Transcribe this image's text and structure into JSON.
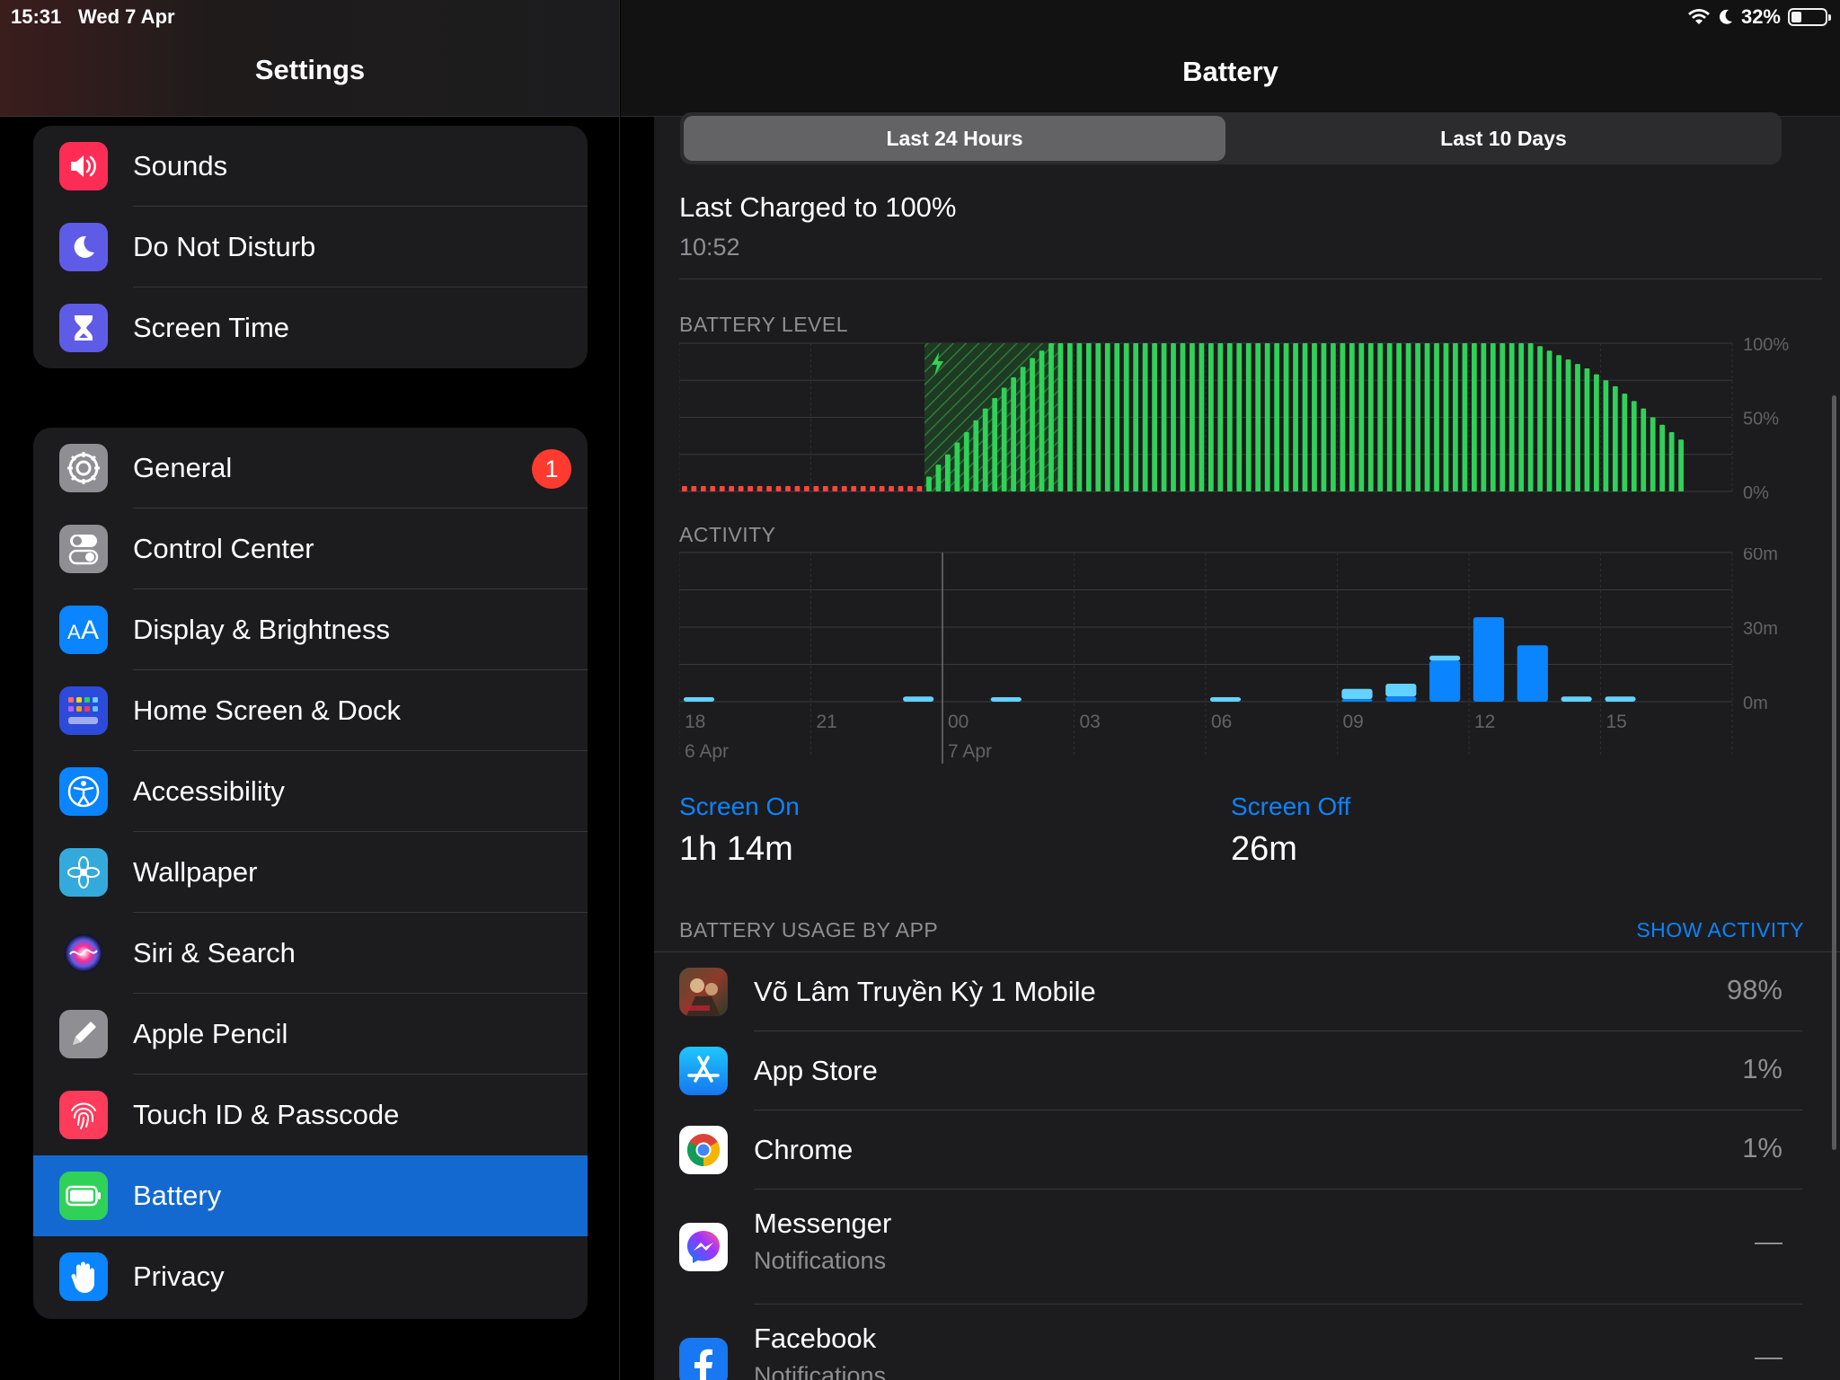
{
  "status_bar": {
    "time": "15:31",
    "date": "Wed 7 Apr",
    "battery_percent": "32%",
    "battery_level": 0.32
  },
  "sidebar": {
    "title": "Settings",
    "group1": [
      {
        "label": "Sounds",
        "icon": "speaker-icon",
        "color": "#ff2d55"
      },
      {
        "label": "Do Not Disturb",
        "icon": "moon-icon",
        "color": "#5e5ce6"
      },
      {
        "label": "Screen Time",
        "icon": "hourglass-icon",
        "color": "#5e5ce6"
      }
    ],
    "group2": [
      {
        "label": "General",
        "icon": "gear-icon",
        "color": "#8e8e93",
        "badge": "1"
      },
      {
        "label": "Control Center",
        "icon": "toggles-icon",
        "color": "#8e8e93"
      },
      {
        "label": "Display & Brightness",
        "icon": "text-size-icon",
        "color": "#0a84ff"
      },
      {
        "label": "Home Screen & Dock",
        "icon": "grid-icon",
        "color": "#2c4bdb"
      },
      {
        "label": "Accessibility",
        "icon": "accessibility-icon",
        "color": "#0a84ff"
      },
      {
        "label": "Wallpaper",
        "icon": "flower-icon",
        "color": "#34aadc"
      },
      {
        "label": "Siri & Search",
        "icon": "siri-icon",
        "color": "#1c1c1e"
      },
      {
        "label": "Apple Pencil",
        "icon": "pencil-icon",
        "color": "#8e8e93"
      },
      {
        "label": "Touch ID & Passcode",
        "icon": "fingerprint-icon",
        "color": "#ff3b5c"
      },
      {
        "label": "Battery",
        "icon": "battery-icon",
        "color": "#30d158",
        "selected": true
      },
      {
        "label": "Privacy",
        "icon": "hand-icon",
        "color": "#0a84ff"
      }
    ]
  },
  "detail": {
    "title": "Battery",
    "segments": [
      "Last 24 Hours",
      "Last 10 Days"
    ],
    "active_segment": "Last 24 Hours",
    "last_charged": "Last Charged to 100%",
    "last_charged_time": "10:52",
    "screen_on_label": "Screen On",
    "screen_on_value": "1h 14m",
    "screen_off_label": "Screen Off",
    "screen_off_value": "26m",
    "usage_header": "BATTERY USAGE BY APP",
    "show_activity": "SHOW ACTIVITY",
    "apps": [
      {
        "name": "Võ Lâm Truyền Kỳ 1 Mobile",
        "pct": "98%",
        "icon": "game-icon"
      },
      {
        "name": "App Store",
        "pct": "1%",
        "icon": "app-store-icon"
      },
      {
        "name": "Chrome",
        "pct": "1%",
        "icon": "chrome-icon"
      },
      {
        "name": "Messenger",
        "sub": "Notifications",
        "pct": "—",
        "icon": "messenger-icon"
      },
      {
        "name": "Facebook",
        "sub": "Notifications",
        "pct": "—",
        "icon": "facebook-icon"
      }
    ]
  },
  "chart_data": [
    {
      "type": "bar",
      "title": "BATTERY LEVEL",
      "y_ticks": [
        "100%",
        "50%",
        "0%"
      ],
      "ylim": [
        0,
        100
      ],
      "colors": {
        "charging": "#30d158",
        "low": "#ff453a"
      },
      "red_low_bar_count": 26,
      "charging_from_bar": 27,
      "values": [
        3,
        3,
        3,
        3,
        3,
        3,
        3,
        3,
        3,
        3,
        3,
        3,
        3,
        3,
        3,
        3,
        3,
        3,
        3,
        3,
        3,
        3,
        3,
        3,
        3,
        3,
        10,
        18,
        25,
        33,
        40,
        48,
        56,
        63,
        70,
        77,
        84,
        90,
        95,
        100,
        100,
        100,
        100,
        100,
        100,
        100,
        100,
        100,
        100,
        100,
        100,
        100,
        100,
        100,
        100,
        100,
        100,
        100,
        100,
        100,
        100,
        100,
        100,
        100,
        100,
        100,
        100,
        100,
        100,
        100,
        100,
        100,
        100,
        100,
        100,
        100,
        100,
        100,
        100,
        100,
        100,
        100,
        100,
        100,
        100,
        100,
        100,
        100,
        100,
        100,
        100,
        98,
        95,
        92,
        89,
        86,
        83,
        79,
        75,
        71,
        66,
        61,
        56,
        50,
        45,
        40,
        35
      ]
    },
    {
      "type": "bar",
      "title": "ACTIVITY",
      "y_ticks": [
        "60m",
        "30m",
        "0m"
      ],
      "ylim": [
        0,
        60
      ],
      "x_ticks": [
        "18",
        "21",
        "00",
        "03",
        "06",
        "09",
        "12",
        "15"
      ],
      "x_subticks": [
        "6 Apr",
        "",
        "7 Apr",
        "",
        "",
        "",
        "",
        ""
      ],
      "screen_on_color": "#0a84ff",
      "screen_off_color": "#64d2ff",
      "hour_bars": [
        {
          "hour": 18,
          "on": 0,
          "off": 1
        },
        {
          "hour": 23,
          "on": 0,
          "off": 2
        },
        {
          "hour": 1,
          "on": 0,
          "off": 1
        },
        {
          "hour": 6,
          "on": 0,
          "off": 1
        },
        {
          "hour": 9,
          "on": 1,
          "off": 4
        },
        {
          "hour": 10,
          "on": 2,
          "off": 5
        },
        {
          "hour": 11,
          "on": 16,
          "off": 2
        },
        {
          "hour": 12,
          "on": 33,
          "off": 0
        },
        {
          "hour": 13,
          "on": 22,
          "off": 0
        },
        {
          "hour": 14,
          "on": 0,
          "off": 2
        },
        {
          "hour": 15,
          "on": 0,
          "off": 2
        }
      ]
    }
  ]
}
